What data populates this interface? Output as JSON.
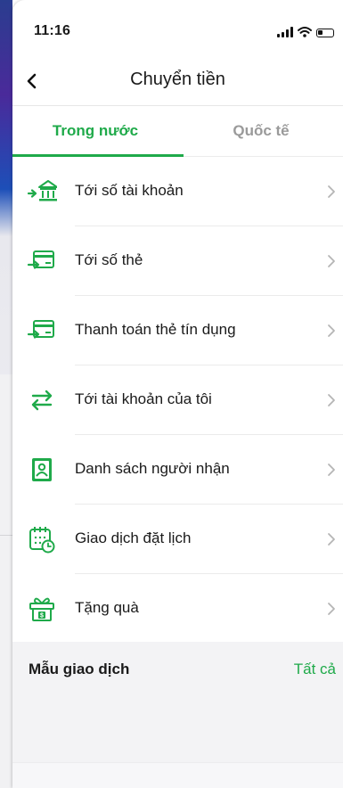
{
  "status_bar": {
    "time": "11:16"
  },
  "nav": {
    "title": "Chuyển tiền"
  },
  "tabs": [
    {
      "label": "Trong nước",
      "active": true
    },
    {
      "label": "Quốc tế",
      "active": false
    }
  ],
  "menu": [
    {
      "label": "Tới số tài khoản",
      "icon": "bank-transfer-icon"
    },
    {
      "label": "Tới số thẻ",
      "icon": "card-transfer-icon"
    },
    {
      "label": "Thanh toán thẻ tín dụng",
      "icon": "credit-card-payment-icon"
    },
    {
      "label": "Tới tài khoản của tôi",
      "icon": "swap-arrows-icon"
    },
    {
      "label": "Danh sách người nhận",
      "icon": "contact-book-icon"
    },
    {
      "label": "Giao dịch đặt lịch",
      "icon": "calendar-clock-icon"
    },
    {
      "label": "Tặng quà",
      "icon": "gift-icon"
    }
  ],
  "templates_section": {
    "title": "Mẫu giao dịch",
    "link": "Tất cả"
  },
  "colors": {
    "accent": "#1faa4a",
    "inactive_tab": "#9a9a9a",
    "section_bg": "#f3f3f5"
  }
}
